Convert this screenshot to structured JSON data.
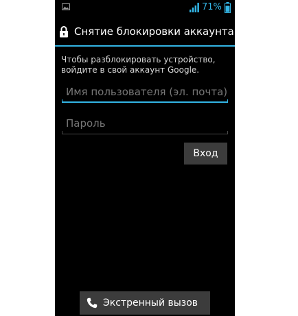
{
  "status_bar": {
    "battery_percent": "71%",
    "accent_color": "#33b5e5",
    "icons": [
      "gallery-icon",
      "signal-icon",
      "battery-icon"
    ]
  },
  "header": {
    "icon": "lock-icon",
    "title": "Снятие блокировки аккаунта"
  },
  "instructions": "Чтобы разблокировать устройство, войдите в свой аккаунт Google.",
  "form": {
    "username": {
      "value": "",
      "placeholder": "Имя пользователя (эл. почта)"
    },
    "password": {
      "value": "",
      "placeholder": "Пароль"
    },
    "login_label": "Вход"
  },
  "emergency": {
    "icon": "phone-icon",
    "label": "Экстренный вызов"
  },
  "colors": {
    "background": "#000000",
    "button": "#3c3c3c",
    "accent": "#33b5e5"
  }
}
